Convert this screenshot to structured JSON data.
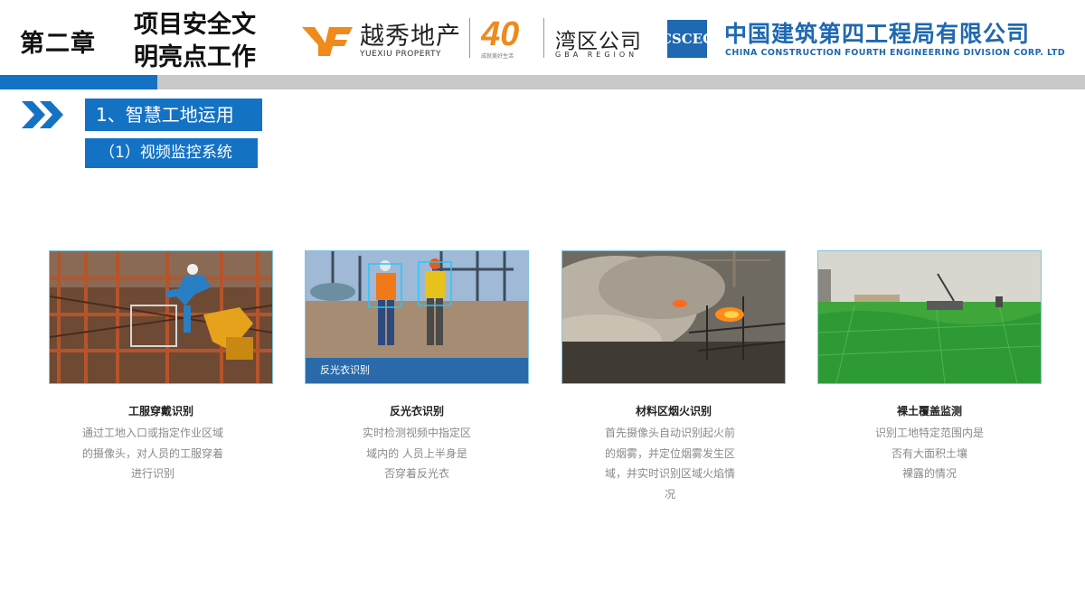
{
  "header": {
    "chapter": "第二章",
    "chapter_title_lines": [
      "项目安全文",
      "明亮点工作"
    ],
    "yuexiu_cn": "越秀地产",
    "yuexiu_en": "YUEXIU PROPERTY",
    "forty": "40",
    "forty_sub": "成就美好生活",
    "gba_cn": "湾区公司",
    "gba_en": "GBA REGION",
    "cscec_logo": "CSCEC",
    "cscec_cn": "中国建筑第四工程局有限公司",
    "cscec_en": "CHINA CONSTRUCTION FOURTH ENGINEERING DIVISION CORP. LTD"
  },
  "section": {
    "title": "1、智慧工地运用",
    "subtitle": "（1）视频监控系统"
  },
  "cards": [
    {
      "title": "工服穿戴识别",
      "desc_lines": [
        "通过工地入口或指定作业区域",
        "的摄像头，对人员的工服穿着",
        "进行识别"
      ],
      "image_caption": ""
    },
    {
      "title": "反光衣识别",
      "desc_lines": [
        "实时检测视频中指定区",
        "域内的 人员上半身是",
        "否穿着反光衣"
      ],
      "image_caption": "反光衣识别"
    },
    {
      "title": "材料区烟火识别",
      "desc_lines": [
        "首先摄像头自动识别起火前",
        "的烟雾，并定位烟雾发生区",
        "域，并实时识别区域火焰情",
        "况"
      ],
      "image_caption": ""
    },
    {
      "title": "裸土覆盖监测",
      "desc_lines": [
        "识别工地特定范围内是",
        "否有大面积土壤",
        "裸露的情况"
      ],
      "image_caption": ""
    }
  ],
  "colors": {
    "brand_blue": "#1472c4",
    "grey_bar": "#c9c9c9",
    "yuexiu_orange": "#f08a1c",
    "cscec_blue": "#1f68b2"
  }
}
